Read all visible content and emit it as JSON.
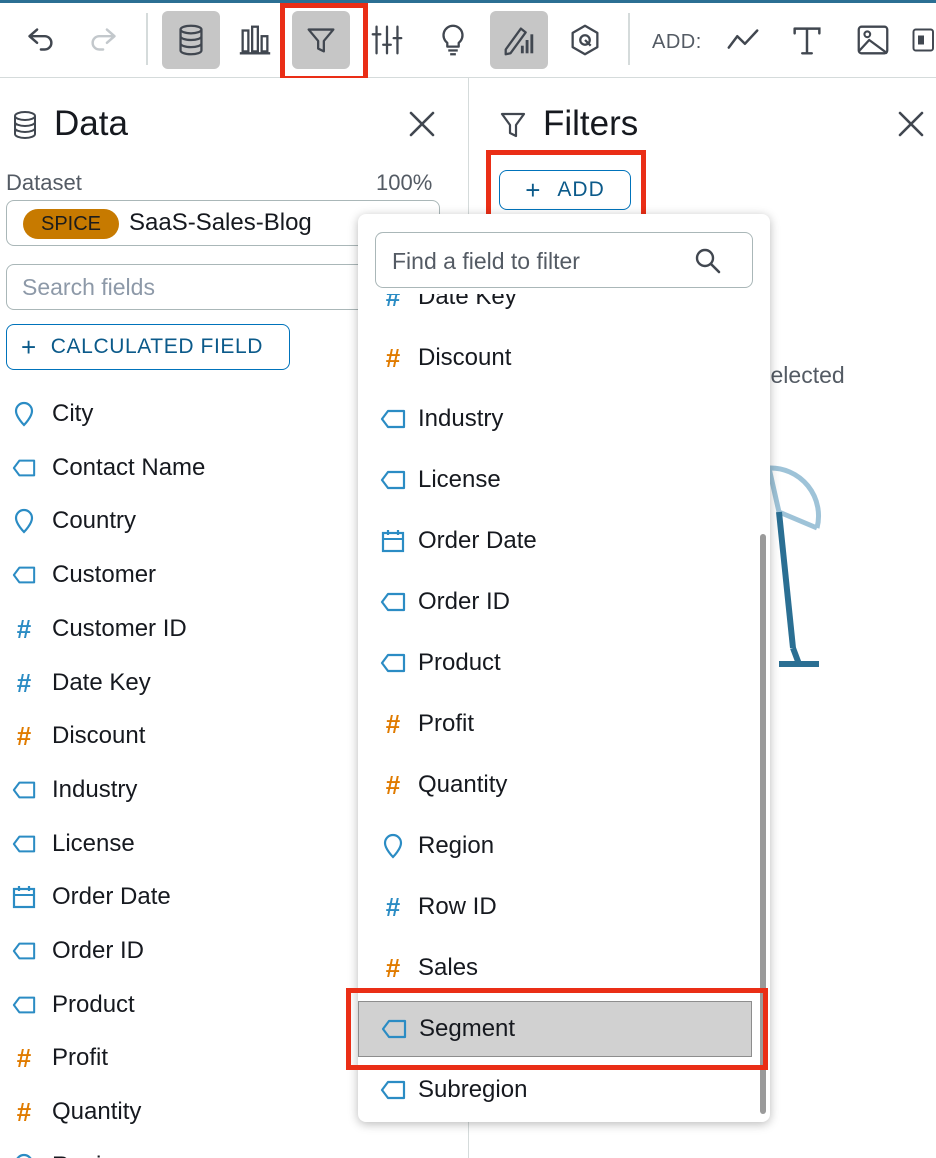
{
  "toolbar": {
    "buttons": [
      {
        "name": "undo-icon"
      },
      {
        "name": "redo-icon"
      },
      {
        "name": "database-icon",
        "active": true
      },
      {
        "name": "visual-types-icon"
      },
      {
        "name": "filter-icon",
        "active": true,
        "highlighted": true
      },
      {
        "name": "parameters-icon"
      },
      {
        "name": "insights-icon"
      },
      {
        "name": "format-visual-icon",
        "active": true
      },
      {
        "name": "themes-icon"
      }
    ],
    "add_label": "ADD:",
    "add_items": [
      "line-chart-icon",
      "text-box-icon",
      "image-icon",
      "more-icon"
    ]
  },
  "data_panel": {
    "title": "Data",
    "dataset_label": "Dataset",
    "dataset_percent": "100%",
    "spice_badge": "SPICE",
    "dataset_name": "SaaS-Sales-Blog",
    "search_placeholder": "Search fields",
    "calc_field_label": "CALCULATED FIELD",
    "fields": [
      {
        "label": "City",
        "type": "geo"
      },
      {
        "label": "Contact Name",
        "type": "dimension"
      },
      {
        "label": "Country",
        "type": "geo"
      },
      {
        "label": "Customer",
        "type": "dimension"
      },
      {
        "label": "Customer ID",
        "type": "number-blue"
      },
      {
        "label": "Date Key",
        "type": "number-blue"
      },
      {
        "label": "Discount",
        "type": "number-orange"
      },
      {
        "label": "Industry",
        "type": "dimension"
      },
      {
        "label": "License",
        "type": "dimension"
      },
      {
        "label": "Order Date",
        "type": "date"
      },
      {
        "label": "Order ID",
        "type": "dimension"
      },
      {
        "label": "Product",
        "type": "dimension"
      },
      {
        "label": "Profit",
        "type": "number-orange"
      },
      {
        "label": "Quantity",
        "type": "number-orange"
      },
      {
        "label": "Region",
        "type": "geo"
      }
    ]
  },
  "filters_panel": {
    "title": "Filters",
    "add_label": "ADD",
    "partial_text": "selected"
  },
  "dropdown": {
    "search_placeholder": "Find a field to filter",
    "items": [
      {
        "label": "Date Key",
        "type": "number-blue"
      },
      {
        "label": "Discount",
        "type": "number-orange"
      },
      {
        "label": "Industry",
        "type": "dimension"
      },
      {
        "label": "License",
        "type": "dimension"
      },
      {
        "label": "Order Date",
        "type": "date"
      },
      {
        "label": "Order ID",
        "type": "dimension"
      },
      {
        "label": "Product",
        "type": "dimension"
      },
      {
        "label": "Profit",
        "type": "number-orange"
      },
      {
        "label": "Quantity",
        "type": "number-orange"
      },
      {
        "label": "Region",
        "type": "geo"
      },
      {
        "label": "Row ID",
        "type": "number-blue"
      },
      {
        "label": "Sales",
        "type": "number-orange"
      },
      {
        "label": "Segment",
        "type": "dimension",
        "selected": true
      },
      {
        "label": "Subregion",
        "type": "dimension"
      }
    ]
  },
  "colors": {
    "accent_blue": "#0073bb",
    "dimension_icon": "#2b8cc4",
    "measure_icon": "#e07b00",
    "spice_badge": "#c77a00",
    "highlight_red": "#ea2e16"
  }
}
